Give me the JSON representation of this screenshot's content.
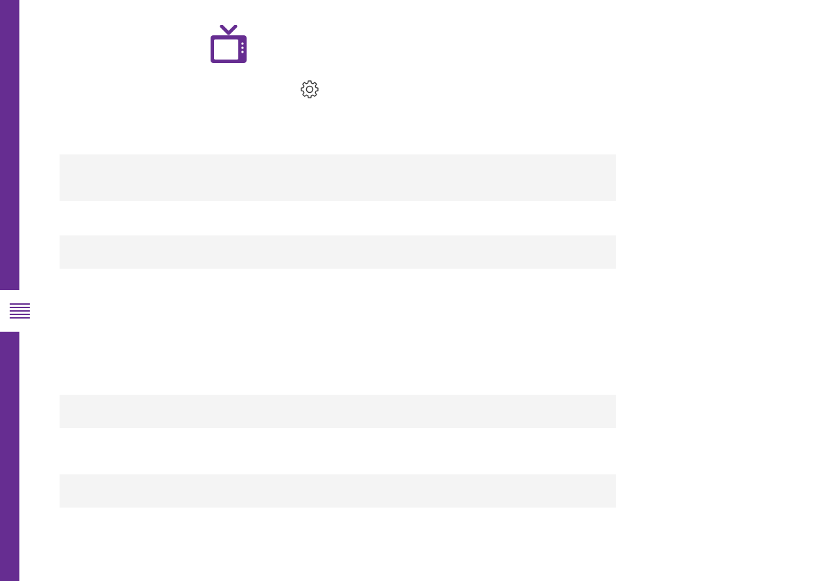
{
  "theme": {
    "accent_color": "#662d91",
    "placeholder_color": "#f4f4f4",
    "background_color": "#ffffff"
  },
  "icons": {
    "menu": "hamburger-menu-icon",
    "logo": "tv-icon",
    "settings": "gear-icon"
  },
  "content": {
    "placeholder_blocks": 4
  }
}
